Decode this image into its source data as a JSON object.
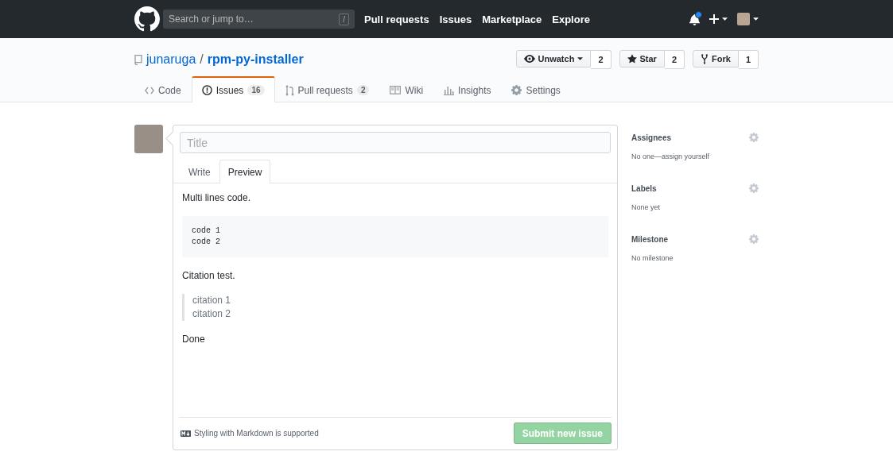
{
  "header": {
    "search": {
      "placeholder": "Search or jump to…",
      "shortcut": "/"
    },
    "nav": [
      "Pull requests",
      "Issues",
      "Marketplace",
      "Explore"
    ],
    "notifications_unread": true
  },
  "repo": {
    "owner": "junaruga",
    "separator": "/",
    "name": "rpm-py-installer",
    "actions": [
      {
        "kind": "watch",
        "label": "Unwatch",
        "dropdown": true,
        "count": "2"
      },
      {
        "kind": "star",
        "label": "Star",
        "dropdown": false,
        "count": "2"
      },
      {
        "kind": "fork",
        "label": "Fork",
        "dropdown": false,
        "count": "1"
      }
    ]
  },
  "tabs": [
    {
      "kind": "code",
      "label": "Code",
      "selected": false
    },
    {
      "kind": "issues",
      "label": "Issues",
      "count": "16",
      "selected": true
    },
    {
      "kind": "pulls",
      "label": "Pull requests",
      "count": "2",
      "selected": false
    },
    {
      "kind": "wiki",
      "label": "Wiki",
      "selected": false
    },
    {
      "kind": "insights",
      "label": "Insights",
      "selected": false
    },
    {
      "kind": "settings",
      "label": "Settings",
      "selected": false
    }
  ],
  "form": {
    "title": {
      "placeholder": "Title"
    },
    "editor_tabs": [
      {
        "label": "Write",
        "selected": false
      },
      {
        "label": "Preview",
        "selected": true
      }
    ],
    "preview": [
      {
        "kind": "paragraph",
        "text": "Multi lines code."
      },
      {
        "kind": "code",
        "lines": [
          "code 1",
          "code 2"
        ]
      },
      {
        "kind": "paragraph",
        "text": "Citation test."
      },
      {
        "kind": "quote",
        "lines": [
          "citation 1",
          "citation 2"
        ]
      },
      {
        "kind": "paragraph",
        "text": "Done"
      }
    ],
    "markdown_note": "Styling with Markdown is supported",
    "submit": {
      "label": "Submit new issue",
      "disabled": true
    }
  },
  "sidebar": [
    {
      "heading": "Assignees",
      "value": "No one—assign yourself"
    },
    {
      "heading": "Labels",
      "value": "None yet"
    },
    {
      "heading": "Milestone",
      "value": "No milestone"
    }
  ]
}
